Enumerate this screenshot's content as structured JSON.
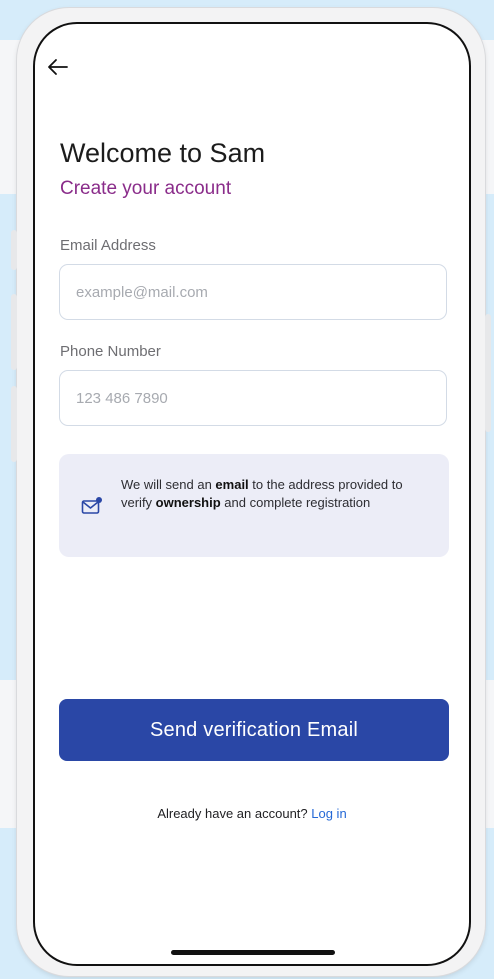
{
  "header": {
    "back_icon": "arrow-left-icon"
  },
  "welcome": {
    "title": "Welcome to Sam",
    "subtitle": "Create your account"
  },
  "form": {
    "email": {
      "label": "Email Address",
      "placeholder": "example@mail.com",
      "value": ""
    },
    "phone": {
      "label": "Phone Number",
      "placeholder": "123 486 7890",
      "value": ""
    }
  },
  "notice": {
    "icon": "mail-notification-icon",
    "text_part1": "We will send an ",
    "text_bold1": "email",
    "text_part2": " to the address provided to verify ",
    "text_bold2": "ownership",
    "text_part3": " and complete registration"
  },
  "actions": {
    "send_button": "Send verification Email"
  },
  "footer": {
    "prompt": "Already have an account? ",
    "login_link": "Log in"
  },
  "colors": {
    "accent": "#2a47a6",
    "subtitle": "#8a2c8a",
    "link": "#2468d6",
    "notice_bg": "#ecedf7",
    "backdrop": "#d6ecfa"
  }
}
